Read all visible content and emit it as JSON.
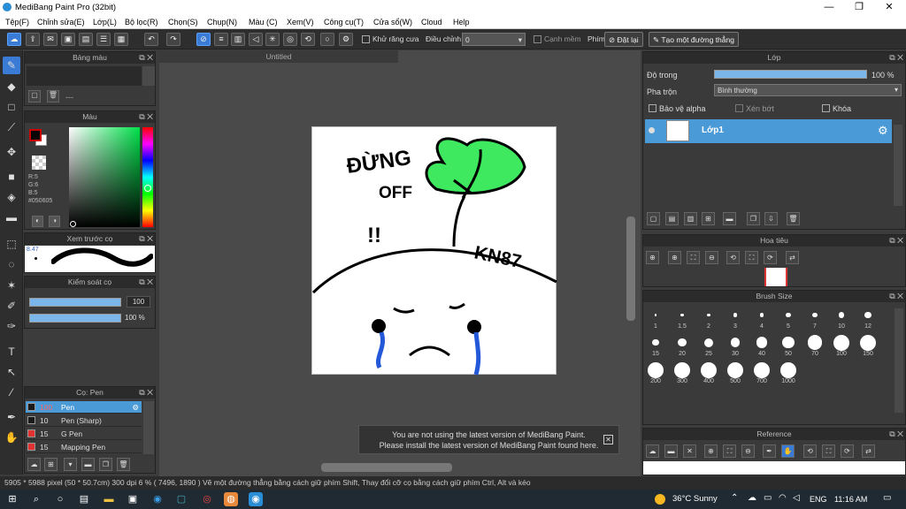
{
  "window": {
    "title": "MediBang Paint Pro (32bit)",
    "minimize": "—",
    "maximize": "❐",
    "close": "✕"
  },
  "menu": [
    "Tệp(F)",
    "Chỉnh sửa(E)",
    "Lớp(L)",
    "Bộ lọc(R)",
    "Chọn(S)",
    "Chụp(N)",
    "Màu (C)",
    "Xem(V)",
    "Công cụ(T)",
    "Cửa sổ(W)",
    "Cloud",
    "Help"
  ],
  "toolbar": {
    "antialias_label": "Khử răng cưa",
    "adjust_label": "Điều chỉnh",
    "adjust_value": "0",
    "edge_label": "Cạnh mềm",
    "key_label": "Phím",
    "reset_label": "Đặt lại",
    "straight_label": "Tạo một đường thẳng"
  },
  "palette_panel": {
    "title": "Bảng màu",
    "dash": "---"
  },
  "color_panel": {
    "title": "Màu",
    "r": "R:5",
    "g": "G:6",
    "b": "B:5",
    "hex": "#050605",
    "fg": "#050605",
    "bg": "#ffffff"
  },
  "preview_panel": {
    "title": "Xem trước cọ",
    "size": "8.47"
  },
  "control_panel": {
    "title": "Kiểm soát cọ",
    "size_value": "100",
    "size_level": 100,
    "opacity_value": "100 %",
    "opacity_level": 100
  },
  "brush_panel": {
    "title": "Cọ: Pen",
    "items": [
      {
        "size": "100",
        "name": "Pen",
        "color": "#1a1a1a",
        "selected": true
      },
      {
        "size": "10",
        "name": "Pen (Sharp)",
        "color": "#1a1a1a",
        "selected": false
      },
      {
        "size": "15",
        "name": "G Pen",
        "color": "#e23232",
        "selected": false
      },
      {
        "size": "15",
        "name": "Mapping Pen",
        "color": "#e23232",
        "selected": false
      }
    ]
  },
  "document": {
    "tab": "Untitled"
  },
  "canvas": {
    "text1": "ĐỪNG",
    "text2": "OFF",
    "text3": "!!",
    "text4": "KN87"
  },
  "notice": {
    "line1": "You are not using the latest version of MediBang Paint.",
    "line2": "Please install the latest version of MediBang Paint found here."
  },
  "layer_panel": {
    "title": "Lớp",
    "opacity_label": "Độ trong",
    "opacity_value": "100 %",
    "opacity_level": 100,
    "blend_label": "Pha trộn",
    "blend_value": "Bình thường",
    "protect_alpha": "Bảo vệ alpha",
    "clipping": "Xén bớt",
    "lock": "Khóa",
    "layer_name": "Lớp1"
  },
  "navigator_panel": {
    "title": "Hoa tiêu"
  },
  "brushsize_panel": {
    "title": "Brush Size",
    "sizes": [
      "1",
      "1.5",
      "2",
      "3",
      "4",
      "5",
      "7",
      "10",
      "12",
      "15",
      "20",
      "25",
      "30",
      "40",
      "50",
      "70",
      "100",
      "150",
      "200",
      "300",
      "400",
      "500",
      "700",
      "1000"
    ]
  },
  "reference_panel": {
    "title": "Reference"
  },
  "status": {
    "text": "5905 * 5988 pixel  (50 * 50.7cm)  300 dpi  6 %  ( 7496, 1890 )  Vẽ một đường thẳng bằng cách giữ phím Shift, Thay đổi cỡ cọ bằng cách giữ phím Ctrl, Alt và kéo"
  },
  "taskbar": {
    "weather": "36°C  Sunny",
    "lang": "ENG",
    "time": "11:16 AM"
  }
}
